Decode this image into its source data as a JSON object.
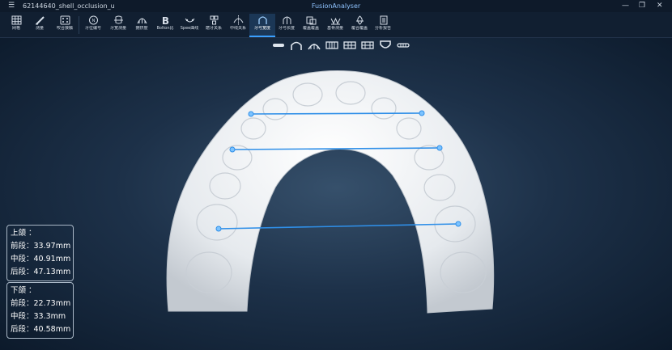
{
  "window": {
    "file_name": "62144640_shell_occlusion_u",
    "app_name": "FusionAnalyser"
  },
  "toolbar": {
    "items": [
      {
        "label": "网格",
        "icon": "grid-icon"
      },
      {
        "label": "测量",
        "icon": "ruler-pen-icon"
      },
      {
        "label": "咬合接触",
        "icon": "occlusion-contact-icon"
      },
      {
        "label": "牙位编号",
        "icon": "tooth-number-icon"
      },
      {
        "label": "牙宽测量",
        "icon": "tooth-width-icon"
      },
      {
        "label": "拥挤度",
        "icon": "crowding-icon"
      },
      {
        "label": "Bolton比",
        "icon": "bolton-b-icon"
      },
      {
        "label": "Spee曲线",
        "icon": "spee-curve-icon"
      },
      {
        "label": "磨牙关系",
        "icon": "molar-relation-icon"
      },
      {
        "label": "中线关系",
        "icon": "midline-icon"
      },
      {
        "label": "牙弓宽度",
        "icon": "arch-width-icon"
      },
      {
        "label": "牙弓长度",
        "icon": "arch-length-icon"
      },
      {
        "label": "覆盖覆盖",
        "icon": "overjet-icon"
      },
      {
        "label": "基骨测量",
        "icon": "basal-bone-icon"
      },
      {
        "label": "覆合覆盖",
        "icon": "overbite-icon"
      },
      {
        "label": "分析报告",
        "icon": "report-icon"
      }
    ],
    "active_index": 10
  },
  "view_buttons": [
    {
      "icon": "occlusal-view-icon"
    },
    {
      "icon": "arch-front-view-icon"
    },
    {
      "icon": "upper-teeth-view-icon"
    },
    {
      "icon": "lower-teeth-view-icon"
    },
    {
      "icon": "left-view-icon"
    },
    {
      "icon": "right-view-icon"
    },
    {
      "icon": "shield-view-icon"
    },
    {
      "icon": "bottom-view-icon"
    }
  ],
  "upper_panel": {
    "title": "上颌 ：",
    "rows": [
      "前段：33.97mm",
      "中段：40.91mm",
      "后段：47.13mm"
    ]
  },
  "lower_panel": {
    "title": "下颌 ：",
    "rows": [
      "前段：22.73mm",
      "中段：33.3mm",
      "后段：40.58mm"
    ]
  },
  "colors": {
    "accent": "#3aa0ff",
    "measure_line": "#2f8fe8",
    "model": "#eef1f4"
  }
}
